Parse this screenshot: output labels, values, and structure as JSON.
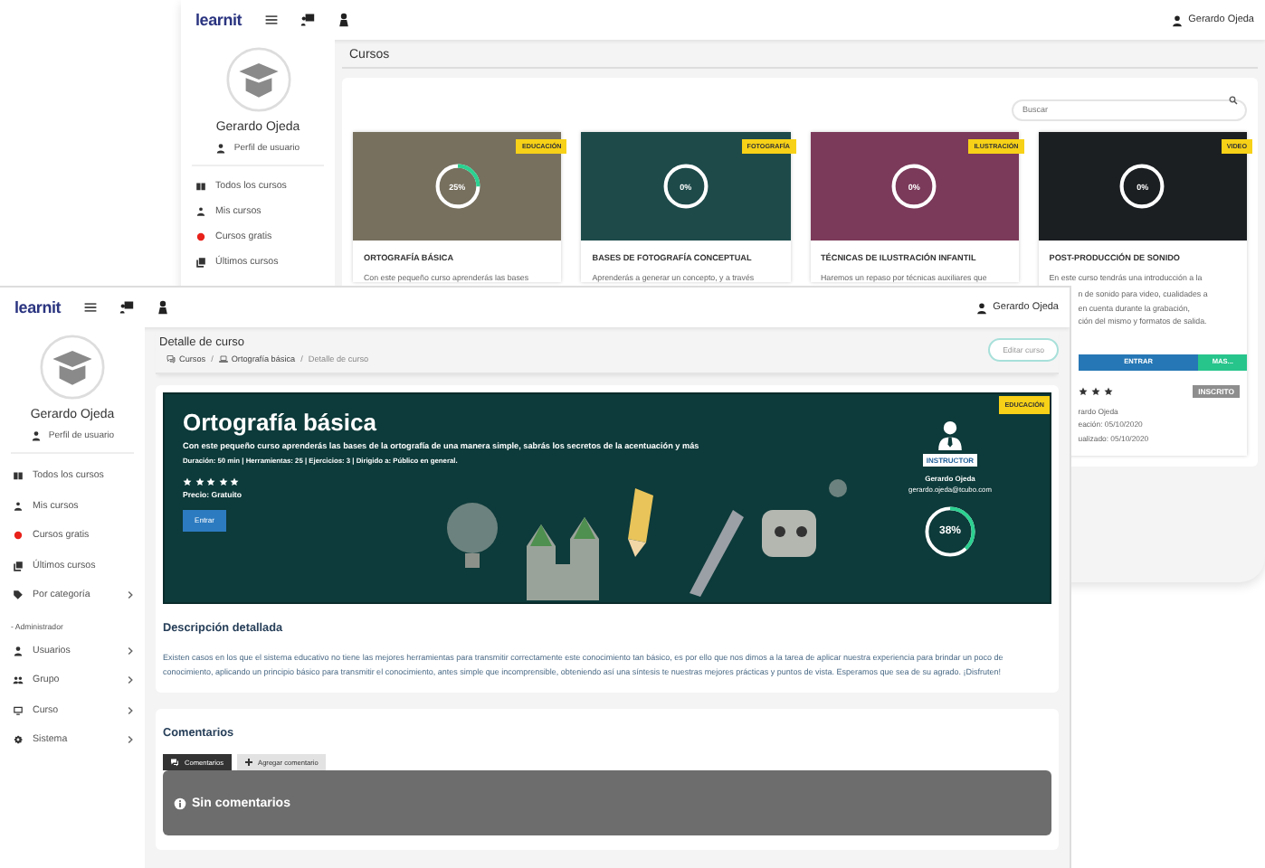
{
  "back_window": {
    "topbar": {
      "logo": "learnit",
      "user": "Gerardo Ojeda"
    },
    "sidebar": {
      "user_name": "Gerardo Ojeda",
      "profile_link": "Perfil de usuario",
      "items": [
        {
          "label": "Todos los cursos"
        },
        {
          "label": "Mis cursos"
        },
        {
          "label": "Cursos gratis"
        },
        {
          "label": "Últimos cursos"
        }
      ]
    },
    "page_title": "Cursos",
    "search": {
      "placeholder": "Buscar"
    },
    "courses": [
      {
        "category": "EDUCACIÓN",
        "progress": "25%",
        "level": 0.25,
        "title": "ORTOGRAFÍA BÁSICA",
        "description": "Con este pequeño curso aprenderás las bases"
      },
      {
        "category": "FOTOGRAFÍA",
        "progress": "0%",
        "level": 0,
        "title": "BASES DE FOTOGRAFÍA CONCEPTUAL",
        "description": "Aprenderás a generar un concepto, y a través"
      },
      {
        "category": "ILUSTRACIÓN",
        "progress": "0%",
        "level": 0,
        "title": "TÉCNICAS DE ILUSTRACIÓN INFANTIL",
        "description": "Haremos un repaso por técnicas auxiliares que"
      },
      {
        "category": "VIDEO",
        "progress": "0%",
        "level": 0,
        "title": "POST-PRODUCCIÓN DE SONIDO",
        "description": "En este curso tendrás una introducción a la"
      }
    ],
    "partial_card": {
      "description_lines": [
        "n de sonido para video, cualidades a",
        "en cuenta durante la grabación,",
        "ción del mismo y formatos de salida."
      ],
      "buttons": [
        {
          "label": "ENTRAR",
          "kind": "primary"
        },
        {
          "label": "MAS...",
          "kind": "secondary"
        }
      ],
      "stars": 3,
      "status": "INSCRITO",
      "meta": [
        "rardo Ojeda",
        "eación: 05/10/2020",
        "ualizado: 05/10/2020"
      ]
    }
  },
  "front_window": {
    "topbar": {
      "logo": "learnit",
      "user": "Gerardo Ojeda"
    },
    "sidebar": {
      "user_name": "Gerardo Ojeda",
      "profile_link": "Perfil de usuario",
      "items": [
        {
          "label": "Todos los cursos",
          "has_submenu": false
        },
        {
          "label": "Mis cursos",
          "has_submenu": false
        },
        {
          "label": "Cursos gratis",
          "has_submenu": false
        },
        {
          "label": "Últimos cursos",
          "has_submenu": false
        },
        {
          "label": "Por categoría",
          "has_submenu": true
        }
      ],
      "section_title": "- Administrador",
      "admin_items": [
        {
          "label": "Usuarios",
          "has_submenu": true
        },
        {
          "label": "Grupo",
          "has_submenu": true
        },
        {
          "label": "Curso",
          "has_submenu": true
        },
        {
          "label": "Sistema",
          "has_submenu": true
        }
      ]
    },
    "header": {
      "title": "Detalle de curso",
      "breadcrumb": [
        "Cursos",
        "Ortografía básica",
        "Detalle de curso"
      ],
      "separator": "/",
      "edit_button": "Editar curso"
    },
    "course_banner": {
      "category": "EDUCACIÓN",
      "title": "Ortografía básica",
      "subtitle": "Con este pequeño curso aprenderás las bases de la ortografía de una manera simple, sabrás los secretos de la acentuación y más",
      "meta": "Duración: 50 min | Herramientas: 25 | Ejercicios: 3 | Dirigido a: Público en general.",
      "stars": 5,
      "price": "Precio: Gratuito",
      "enter_button": "Entrar",
      "instructor": {
        "badge": "INSTRUCTOR",
        "name": "Gerardo Ojeda",
        "email": "gerardo.ojeda@tcubo.com"
      },
      "progress": "38%",
      "level": 0.38
    },
    "description": {
      "heading": "Descripción detallada",
      "text": "Existen casos en los que el sistema educativo no tiene las mejores herramientas para transmitir correctamente este conocimiento tan básico, es por ello que nos dimos a la tarea de aplicar nuestra experiencia para brindar un poco de conocimiento, aplicando un principio básico para transmitir el conocimiento, antes simple que incomprensible, obteniendo así una síntesis te nuestras mejores prácticas y puntos de vista. Esperamos que sea de su agrado. ¡Disfruten!"
    },
    "comments": {
      "heading": "Comentarios",
      "tabs": [
        {
          "label": "Comentarios",
          "selected": true
        },
        {
          "label": "Agregar comentario",
          "selected": false
        }
      ],
      "empty_message": "Sin comentarios"
    }
  }
}
